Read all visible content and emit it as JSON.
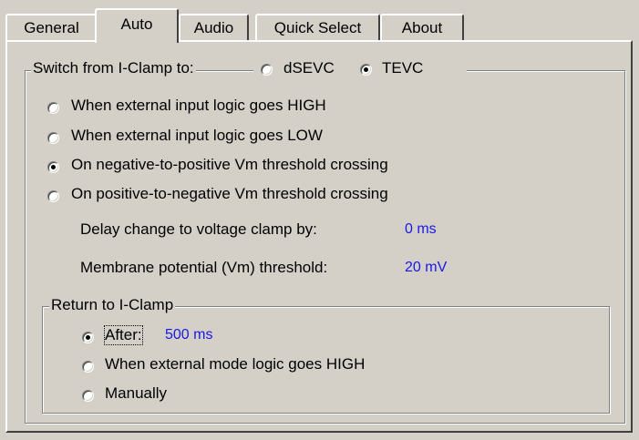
{
  "tabs": [
    {
      "label": "General"
    },
    {
      "label": "Auto"
    },
    {
      "label": "Audio"
    },
    {
      "label": "Quick Select"
    },
    {
      "label": "About"
    }
  ],
  "switch_group": {
    "legend": "Switch from I-Clamp to:",
    "modes": [
      {
        "label": "dSEVC",
        "checked": false
      },
      {
        "label": "TEVC",
        "checked": true
      }
    ],
    "options": [
      {
        "label": "When external input logic goes HIGH",
        "checked": false
      },
      {
        "label": "When external input logic goes LOW",
        "checked": false
      },
      {
        "label": "On negative-to-positive Vm threshold crossing",
        "checked": true
      },
      {
        "label": "On positive-to-negative Vm threshold crossing",
        "checked": false
      }
    ],
    "delay_label": "Delay change to voltage clamp by:",
    "delay_value": "0 ms",
    "threshold_label": "Membrane potential (Vm) threshold:",
    "threshold_value": "20 mV"
  },
  "return_group": {
    "legend": "Return to I-Clamp",
    "after_label": "After:",
    "after_value": "500 ms",
    "after_checked": true,
    "mode_logic_label": "When external mode logic goes HIGH",
    "mode_logic_checked": false,
    "manually_label": "Manually",
    "manually_checked": false
  },
  "colors": {
    "face": "#d4d0c8",
    "value_text": "#1818e6"
  }
}
